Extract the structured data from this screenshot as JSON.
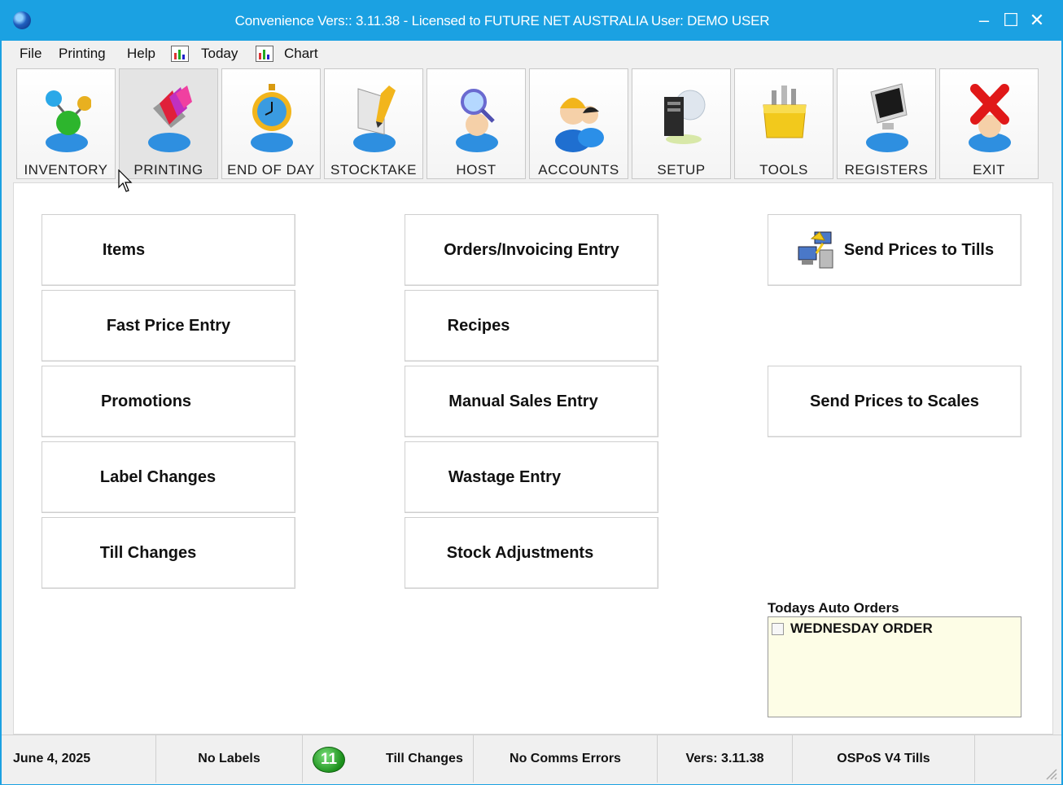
{
  "window": {
    "title": "Convenience Vers:: 3.11.38 - Licensed to FUTURE NET AUSTRALIA  User: DEMO USER",
    "minimize": "–",
    "maximize": "☐",
    "close": "✕"
  },
  "menu": {
    "file": "File",
    "printing": "Printing",
    "help": "Help",
    "today": "Today",
    "chart": "Chart"
  },
  "toolbar": {
    "active": "PRINTING",
    "items": [
      {
        "label": "INVENTORY",
        "icon": "inventory-molecule-icon"
      },
      {
        "label": "PRINTING",
        "icon": "printing-colors-icon"
      },
      {
        "label": "END OF DAY",
        "icon": "clock-icon"
      },
      {
        "label": "STOCKTAKE",
        "icon": "stocktake-pencil-icon"
      },
      {
        "label": "HOST",
        "icon": "magnifier-icon"
      },
      {
        "label": "ACCOUNTS",
        "icon": "users-icon"
      },
      {
        "label": "SETUP",
        "icon": "computer-icon"
      },
      {
        "label": "TOOLS",
        "icon": "toolbox-icon"
      },
      {
        "label": "REGISTERS",
        "icon": "monitor-icon"
      },
      {
        "label": "EXIT",
        "icon": "exit-x-icon"
      }
    ]
  },
  "main": {
    "col1": [
      "Items",
      "Fast Price Entry",
      "Promotions",
      "Label Changes",
      "Till Changes"
    ],
    "col2": [
      "Orders/Invoicing Entry",
      "Recipes",
      "Manual Sales Entry",
      "Wastage Entry",
      "Stock Adjustments"
    ],
    "send_tills": "Send Prices to Tills",
    "send_scales": "Send Prices to Scales"
  },
  "auto_orders": {
    "label": "Todays Auto Orders",
    "items": [
      {
        "label": "WEDNESDAY ORDER",
        "checked": false
      }
    ]
  },
  "status": {
    "date": "June 4, 2025",
    "labels": "No Labels",
    "badge": "11",
    "till_changes": "Till Changes",
    "comms": "No Comms Errors",
    "version": "Vers: 3.11.38",
    "tills": "OSPoS V4 Tills"
  },
  "colors": {
    "titlebar": "#1ba1e2",
    "autobox": "#fdfde6",
    "badge": "#1b8f1b"
  }
}
